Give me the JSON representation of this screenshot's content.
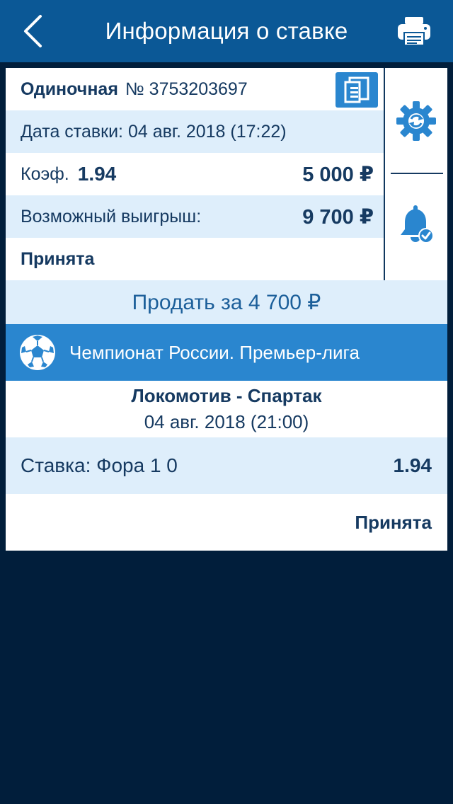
{
  "header": {
    "title": "Информация о ставке",
    "back_icon": "chevron-left-icon",
    "print_icon": "printer-icon"
  },
  "bet": {
    "type_label": "Одиночная",
    "number": "№ 3753203697",
    "date_line": "Дата ставки: 04 авг. 2018 (17:22)",
    "coef_label": "Коэф.",
    "coef_value": "1.94",
    "amount": "5 000 ₽",
    "possible_win_label": "Возможный выигрыш:",
    "possible_win_value": "9 700 ₽",
    "status": "Принята"
  },
  "actions": {
    "sell_label": "Продать за 4 700 ₽",
    "copy_icon": "copy-icon",
    "settings_icon": "gear-refresh-icon",
    "notify_icon": "bell-check-icon"
  },
  "event": {
    "league": "Чемпионат России. Премьер-лига",
    "league_icon": "soccer-ball-icon",
    "teams": "Локомотив - Спартак",
    "date": "04 авг. 2018 (21:00)",
    "stake": "Ставка: Фора 1 0",
    "odd": "1.94",
    "status": "Принята"
  },
  "colors": {
    "header_bg": "#0b5896",
    "page_bg": "#011e3b",
    "accent": "#2a86cf",
    "row_light": "#deeefb",
    "text_dark": "#163a61"
  }
}
